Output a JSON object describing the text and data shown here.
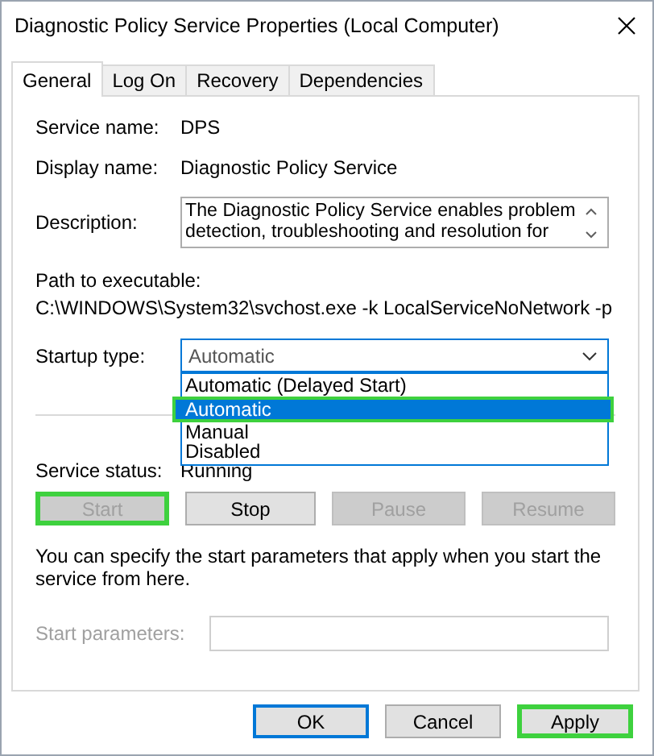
{
  "window": {
    "title": "Diagnostic Policy Service Properties (Local Computer)"
  },
  "tabs": [
    {
      "label": "General",
      "selected": true
    },
    {
      "label": "Log On",
      "selected": false
    },
    {
      "label": "Recovery",
      "selected": false
    },
    {
      "label": "Dependencies",
      "selected": false
    }
  ],
  "service_name": {
    "label": "Service name:",
    "value": "DPS"
  },
  "display_name": {
    "label": "Display name:",
    "value": "Diagnostic Policy Service"
  },
  "description": {
    "label": "Description:",
    "value": "The Diagnostic Policy Service enables problem detection, troubleshooting and resolution for"
  },
  "path": {
    "label": "Path to executable:",
    "value": "C:\\WINDOWS\\System32\\svchost.exe -k LocalServiceNoNetwork -p"
  },
  "startup_type": {
    "label": "Startup type:",
    "value": "Automatic",
    "expanded": true,
    "options": [
      {
        "label": "Automatic (Delayed Start)",
        "selected": false,
        "highlighted": false
      },
      {
        "label": "Automatic",
        "selected": true,
        "highlighted": true
      },
      {
        "label": "Manual",
        "selected": false,
        "highlighted": false
      },
      {
        "label": "Disabled",
        "selected": false,
        "highlighted": false
      }
    ]
  },
  "service_status": {
    "label": "Service status:",
    "value": "Running"
  },
  "service_buttons": [
    {
      "label": "Start",
      "disabled": true,
      "highlighted": true
    },
    {
      "label": "Stop",
      "disabled": false,
      "highlighted": false
    },
    {
      "label": "Pause",
      "disabled": true,
      "highlighted": false
    },
    {
      "label": "Resume",
      "disabled": true,
      "highlighted": false
    }
  ],
  "note": "You can specify the start parameters that apply when you start the service from here.",
  "start_parameters": {
    "label": "Start parameters:",
    "disabled": true
  },
  "buttons": [
    {
      "label": "OK",
      "default": true,
      "highlighted": false
    },
    {
      "label": "Cancel",
      "default": false,
      "highlighted": false
    },
    {
      "label": "Apply",
      "default": false,
      "highlighted": true
    }
  ]
}
